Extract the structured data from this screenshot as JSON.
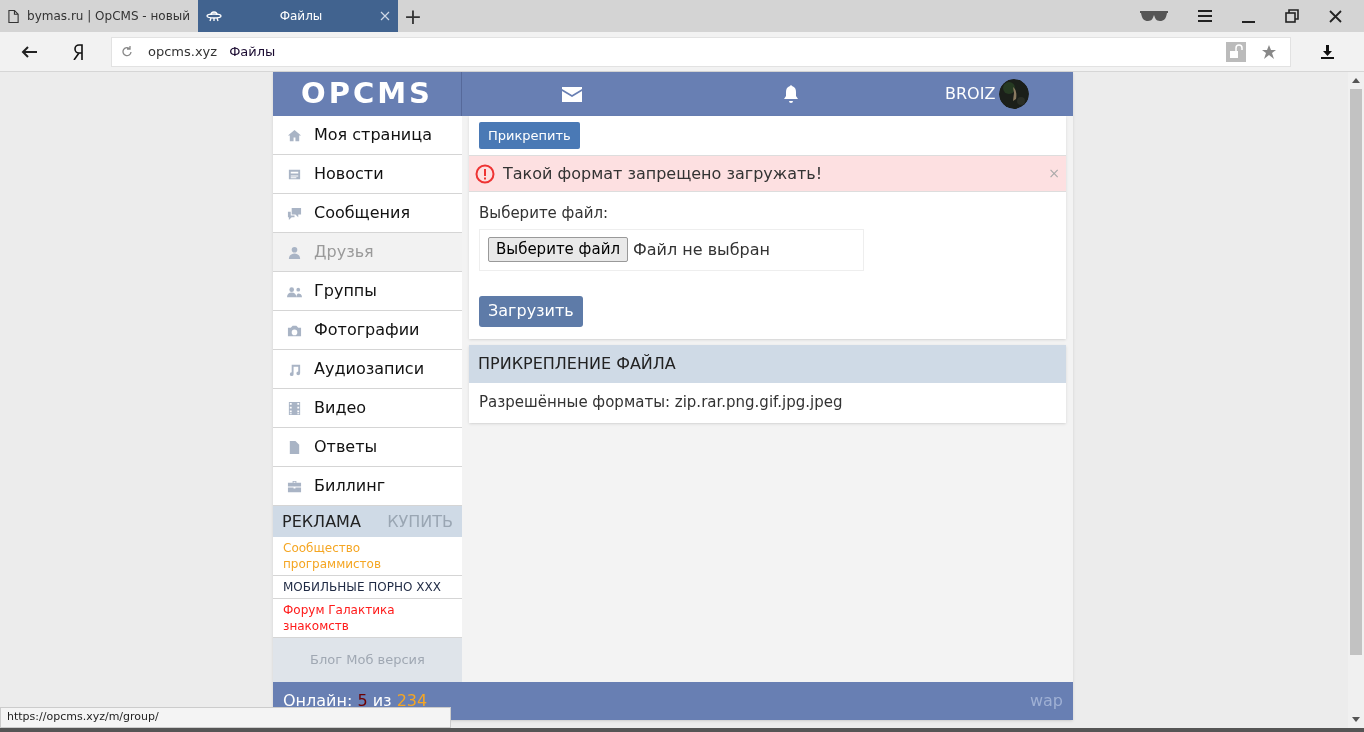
{
  "browser": {
    "tabs": [
      {
        "title": "bymas.ru | OpCMS - новый",
        "selected": false
      },
      {
        "title": "Файлы",
        "selected": true
      }
    ],
    "new_tab": "+",
    "address": {
      "domain": "opcms.xyz",
      "title": "Файлы"
    }
  },
  "header": {
    "logo": "OPCMS",
    "user": "BROIZ"
  },
  "sidebar": {
    "items": [
      {
        "label": "Моя страница",
        "selected": false
      },
      {
        "label": "Новости",
        "selected": false
      },
      {
        "label": "Сообщения",
        "selected": false
      },
      {
        "label": "Друзья",
        "selected": true
      },
      {
        "label": "Группы",
        "selected": false
      },
      {
        "label": "Фотографии",
        "selected": false
      },
      {
        "label": "Аудиозаписи",
        "selected": false
      },
      {
        "label": "Видео",
        "selected": false
      },
      {
        "label": "Ответы",
        "selected": false
      },
      {
        "label": "Биллинг",
        "selected": false
      }
    ],
    "ads": {
      "title": "РЕКЛАМА",
      "buy": "КУПИТЬ",
      "links": [
        {
          "text": "Сообщество программистов",
          "color": "#f5a623"
        },
        {
          "text": "МОБИЛЬНЫЕ ПОРНО XXX",
          "color": "#1f2a44"
        },
        {
          "text": "Форум Галактика знакомств",
          "color": "#ff1a1a"
        }
      ]
    },
    "bottom_link": "Блог Моб версия"
  },
  "main": {
    "attach_button": "Прикрепить",
    "alert": {
      "message": "Такой формат запрещено загружать!",
      "close": "×"
    },
    "file_label": "Выберите файл:",
    "file_button": "Выберите файл",
    "file_status": "Файл не выбран",
    "upload_button": "Загрузить",
    "section": {
      "title": "ПРИКРЕПЛЕНИЕ ФАЙЛА",
      "text": "Разрешённые форматы: zip.rar.png.gif.jpg.jpeg"
    }
  },
  "footer": {
    "online_label": "Онлайн:",
    "online": "5",
    "of": "из",
    "total": "234",
    "wap": "wap"
  },
  "status_url": "https://opcms.xyz/m/group/"
}
